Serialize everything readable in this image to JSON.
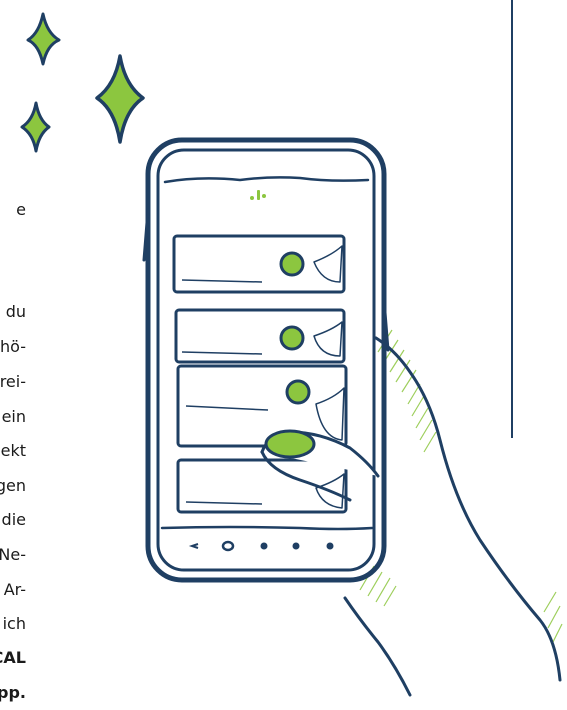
{
  "text_fragments": [
    {
      "id": "l0",
      "text": "e",
      "bold": false
    },
    {
      "id": "l1",
      "text": "du",
      "bold": false
    },
    {
      "id": "l2",
      "text": "hö-",
      "bold": false
    },
    {
      "id": "l3",
      "text": "rei-",
      "bold": false
    },
    {
      "id": "l4",
      "text": "ein",
      "bold": false
    },
    {
      "id": "l5",
      "text": "ekt",
      "bold": false
    },
    {
      "id": "l6",
      "text": "gen",
      "bold": false
    },
    {
      "id": "l7",
      "text": "die",
      "bold": false
    },
    {
      "id": "l8",
      "text": "Ne-",
      "bold": false
    },
    {
      "id": "l9",
      "text": "Ar-",
      "bold": false
    },
    {
      "id": "l10",
      "text": "ich",
      "bold": false
    },
    {
      "id": "l11",
      "text": "CAL",
      "bold": true
    },
    {
      "id": "l12",
      "text": "pp.",
      "bold": true
    }
  ],
  "illustration": {
    "subject": "hand-holding-smartphone-illustration",
    "stroke_color": "#1f3f63",
    "accent_color": "#8cc63f",
    "card_count": 4,
    "nav_icons": [
      "back-icon",
      "home-icon",
      "menu-icon",
      "menu-icon",
      "menu-icon"
    ]
  }
}
